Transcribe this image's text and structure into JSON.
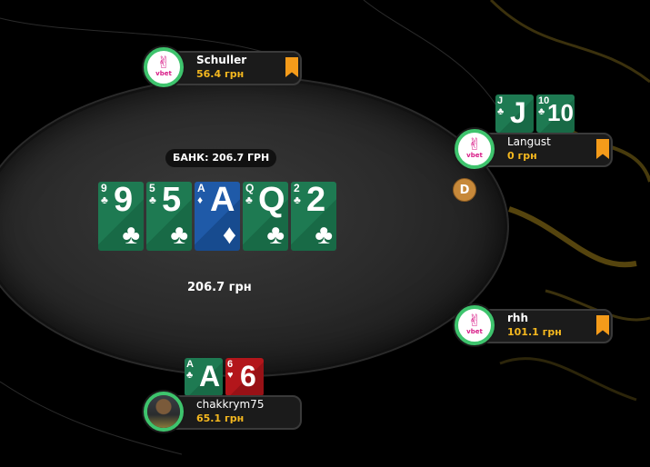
{
  "pot": {
    "label": "БАНК: 206.7 ГРН",
    "amount": "206.7 грн"
  },
  "board": [
    {
      "rank": "9",
      "suit": "clubs",
      "suit_glyph": "♣"
    },
    {
      "rank": "5",
      "suit": "clubs",
      "suit_glyph": "♣"
    },
    {
      "rank": "A",
      "suit": "diamonds",
      "suit_glyph": "♦"
    },
    {
      "rank": "Q",
      "suit": "clubs",
      "suit_glyph": "♣"
    },
    {
      "rank": "2",
      "suit": "clubs",
      "suit_glyph": "♣"
    }
  ],
  "players": {
    "schuller": {
      "name": "Schuller",
      "stack": "56.4 грн",
      "avatar_logo": "✌",
      "avatar_text": "vbet"
    },
    "langust": {
      "name": "Langust",
      "stack": "0 грн",
      "avatar_logo": "✌",
      "avatar_text": "vbet",
      "hand": [
        {
          "rank": "J",
          "suit": "clubs",
          "suit_glyph": "♣"
        },
        {
          "rank": "10",
          "suit": "clubs",
          "suit_glyph": "♣"
        }
      ]
    },
    "rhh": {
      "name": "rhh",
      "stack": "101.1 грн",
      "avatar_logo": "✌",
      "avatar_text": "vbet"
    },
    "chakkrym75": {
      "name": "chakkrym75",
      "stack": "65.1 грн",
      "hand": [
        {
          "rank": "A",
          "suit": "clubs",
          "suit_glyph": "♣"
        },
        {
          "rank": "6",
          "suit": "hearts",
          "suit_glyph": "♥"
        }
      ]
    }
  },
  "dealer_button": "D",
  "colors": {
    "stack": "#f5b81f",
    "flag": "#f49b1a",
    "avatar_ring": "#3ec46d",
    "vbet_pink": "#d81b87"
  }
}
